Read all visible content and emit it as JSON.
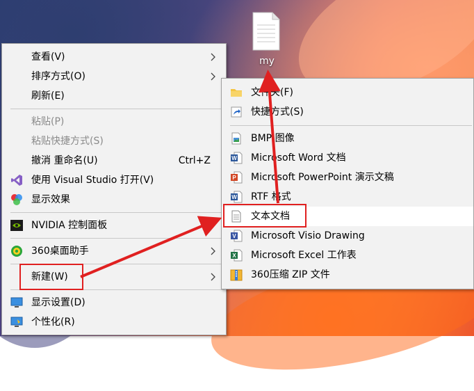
{
  "desktop": {
    "file_label": "my"
  },
  "context_menu": {
    "items": [
      {
        "label": "查看(V)"
      },
      {
        "label": "排序方式(O)"
      },
      {
        "label": "刷新(E)"
      },
      {
        "label": "粘贴(P)"
      },
      {
        "label": "粘贴快捷方式(S)"
      },
      {
        "label": "撤消 重命名(U)",
        "shortcut": "Ctrl+Z"
      },
      {
        "label": "使用 Visual Studio 打开(V)"
      },
      {
        "label": "显示效果"
      },
      {
        "label": "NVIDIA 控制面板"
      },
      {
        "label": "360桌面助手"
      },
      {
        "label": "新建(W)"
      },
      {
        "label": "显示设置(D)"
      },
      {
        "label": "个性化(R)"
      }
    ]
  },
  "new_submenu": {
    "items": [
      {
        "label": "文件夹(F)"
      },
      {
        "label": "快捷方式(S)"
      },
      {
        "label": "BMP 图像"
      },
      {
        "label": "Microsoft Word 文档"
      },
      {
        "label": "Microsoft PowerPoint 演示文稿"
      },
      {
        "label": "RTF 格式"
      },
      {
        "label": "文本文档"
      },
      {
        "label": "Microsoft Visio Drawing"
      },
      {
        "label": "Microsoft Excel 工作表"
      },
      {
        "label": "360压缩 ZIP 文件"
      }
    ]
  },
  "colors": {
    "highlight_red": "#e02020",
    "menu_bg": "#f2f2f2",
    "hover_bg": "#ffffff"
  }
}
